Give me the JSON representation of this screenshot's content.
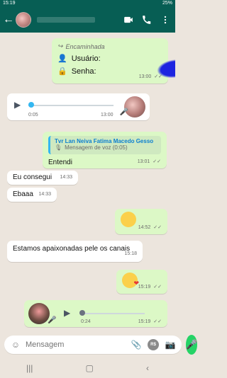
{
  "status": {
    "time": "15:19",
    "battery": "25%"
  },
  "header": {
    "contact_name": ""
  },
  "chat": {
    "forwarded": {
      "label": "Encaminhada",
      "usuario_label": "Usuário:",
      "senha_label": "Senha:",
      "time": "13:00",
      "ticks": "✓✓"
    },
    "voice_in": {
      "duration": "0:05",
      "time": "13:00"
    },
    "reply": {
      "quoted_name": "Tvr Lan Neiva Fatima Macedo Gesso",
      "quoted_type": "Mensagem de voz (0:05)",
      "text": "Entendi",
      "time": "13:01",
      "ticks": "✓✓"
    },
    "incoming_1": {
      "text": "Eu consegui",
      "time": "14:33"
    },
    "incoming_2": {
      "text": "Ebaaa",
      "time": "14:33"
    },
    "emoji_1": {
      "time": "14:52",
      "ticks": "✓✓"
    },
    "long_message": {
      "text": "Estamos apaixonadas pele os canais",
      "time": "15:18"
    },
    "emoji_2": {
      "time": "15:19",
      "ticks": "✓✓"
    },
    "voice_out": {
      "duration": "0:24",
      "time": "15:19",
      "ticks": "✓✓"
    }
  },
  "composer": {
    "placeholder": "Mensagem",
    "rs_label": "R$"
  }
}
